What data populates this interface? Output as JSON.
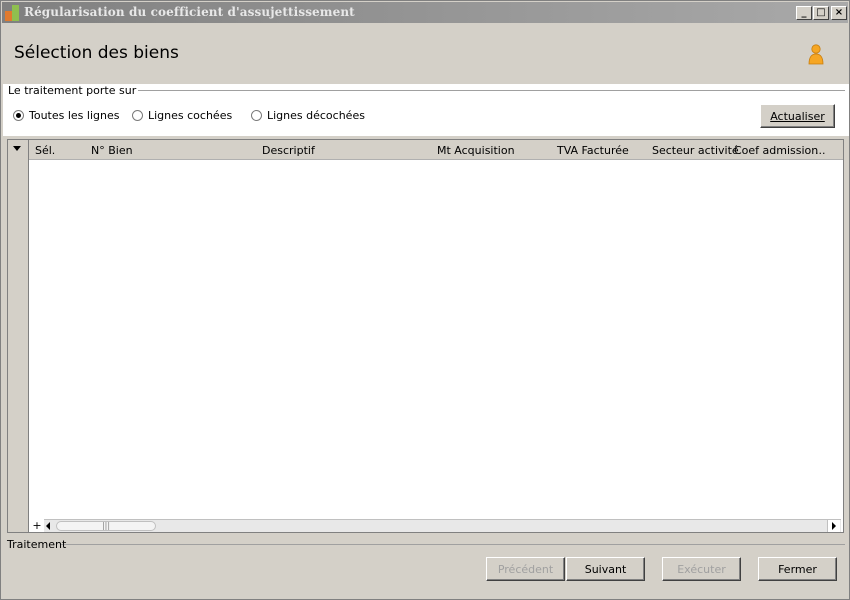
{
  "window": {
    "title": "Régularisation du coefficient d'assujettissement",
    "controls": {
      "minimize": "_",
      "maximize": "□",
      "close": "×"
    }
  },
  "header": {
    "title": "Sélection des biens",
    "icon": "user-icon"
  },
  "filter": {
    "legend": "Le traitement porte sur",
    "options": [
      {
        "label": "Toutes les lignes",
        "checked": true
      },
      {
        "label": "Lignes cochées",
        "checked": false
      },
      {
        "label": "Lignes décochées",
        "checked": false
      }
    ],
    "refresh_label": "Actualiser"
  },
  "grid": {
    "columns": [
      "Sél.",
      "N° Bien",
      "Descriptif",
      "Mt Acquisition",
      "TVA Facturée",
      "Secteur activité",
      "Coef admission",
      "..."
    ],
    "rows": [],
    "add_symbol": "+",
    "scroll_grip": "|||"
  },
  "footer": {
    "legend": "Traitement",
    "buttons": {
      "previous": "Précédent",
      "next": "Suivant",
      "execute": "Exécuter",
      "close": "Fermer"
    }
  }
}
